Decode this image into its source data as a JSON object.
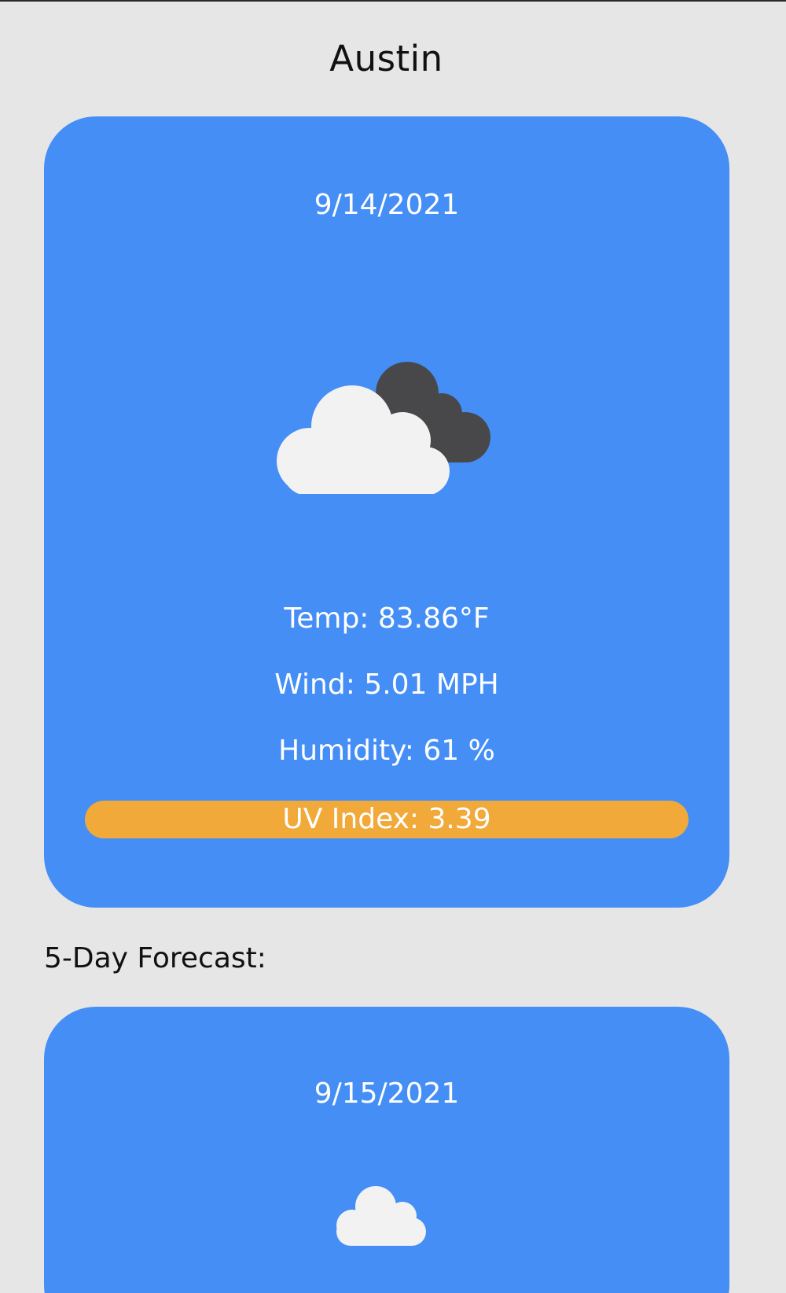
{
  "city": "Austin",
  "current": {
    "date": "9/14/2021",
    "icon": "partly-cloudy-icon",
    "temp": "Temp: 83.86°F",
    "wind": "Wind: 5.01 MPH",
    "humidity": "Humidity: 61 %",
    "uv_index": "UV Index: 3.39",
    "uv_color": "#f1a93a"
  },
  "forecast": {
    "heading": "5-Day Forecast:",
    "days": [
      {
        "date": "9/15/2021",
        "icon": "cloud-icon"
      }
    ]
  },
  "colors": {
    "background": "#e6e6e6",
    "card": "#448ef6",
    "cloud_light": "#f2f2f2",
    "cloud_dark": "#48484a",
    "text_dark": "#111111",
    "text_light": "#ffffff"
  }
}
